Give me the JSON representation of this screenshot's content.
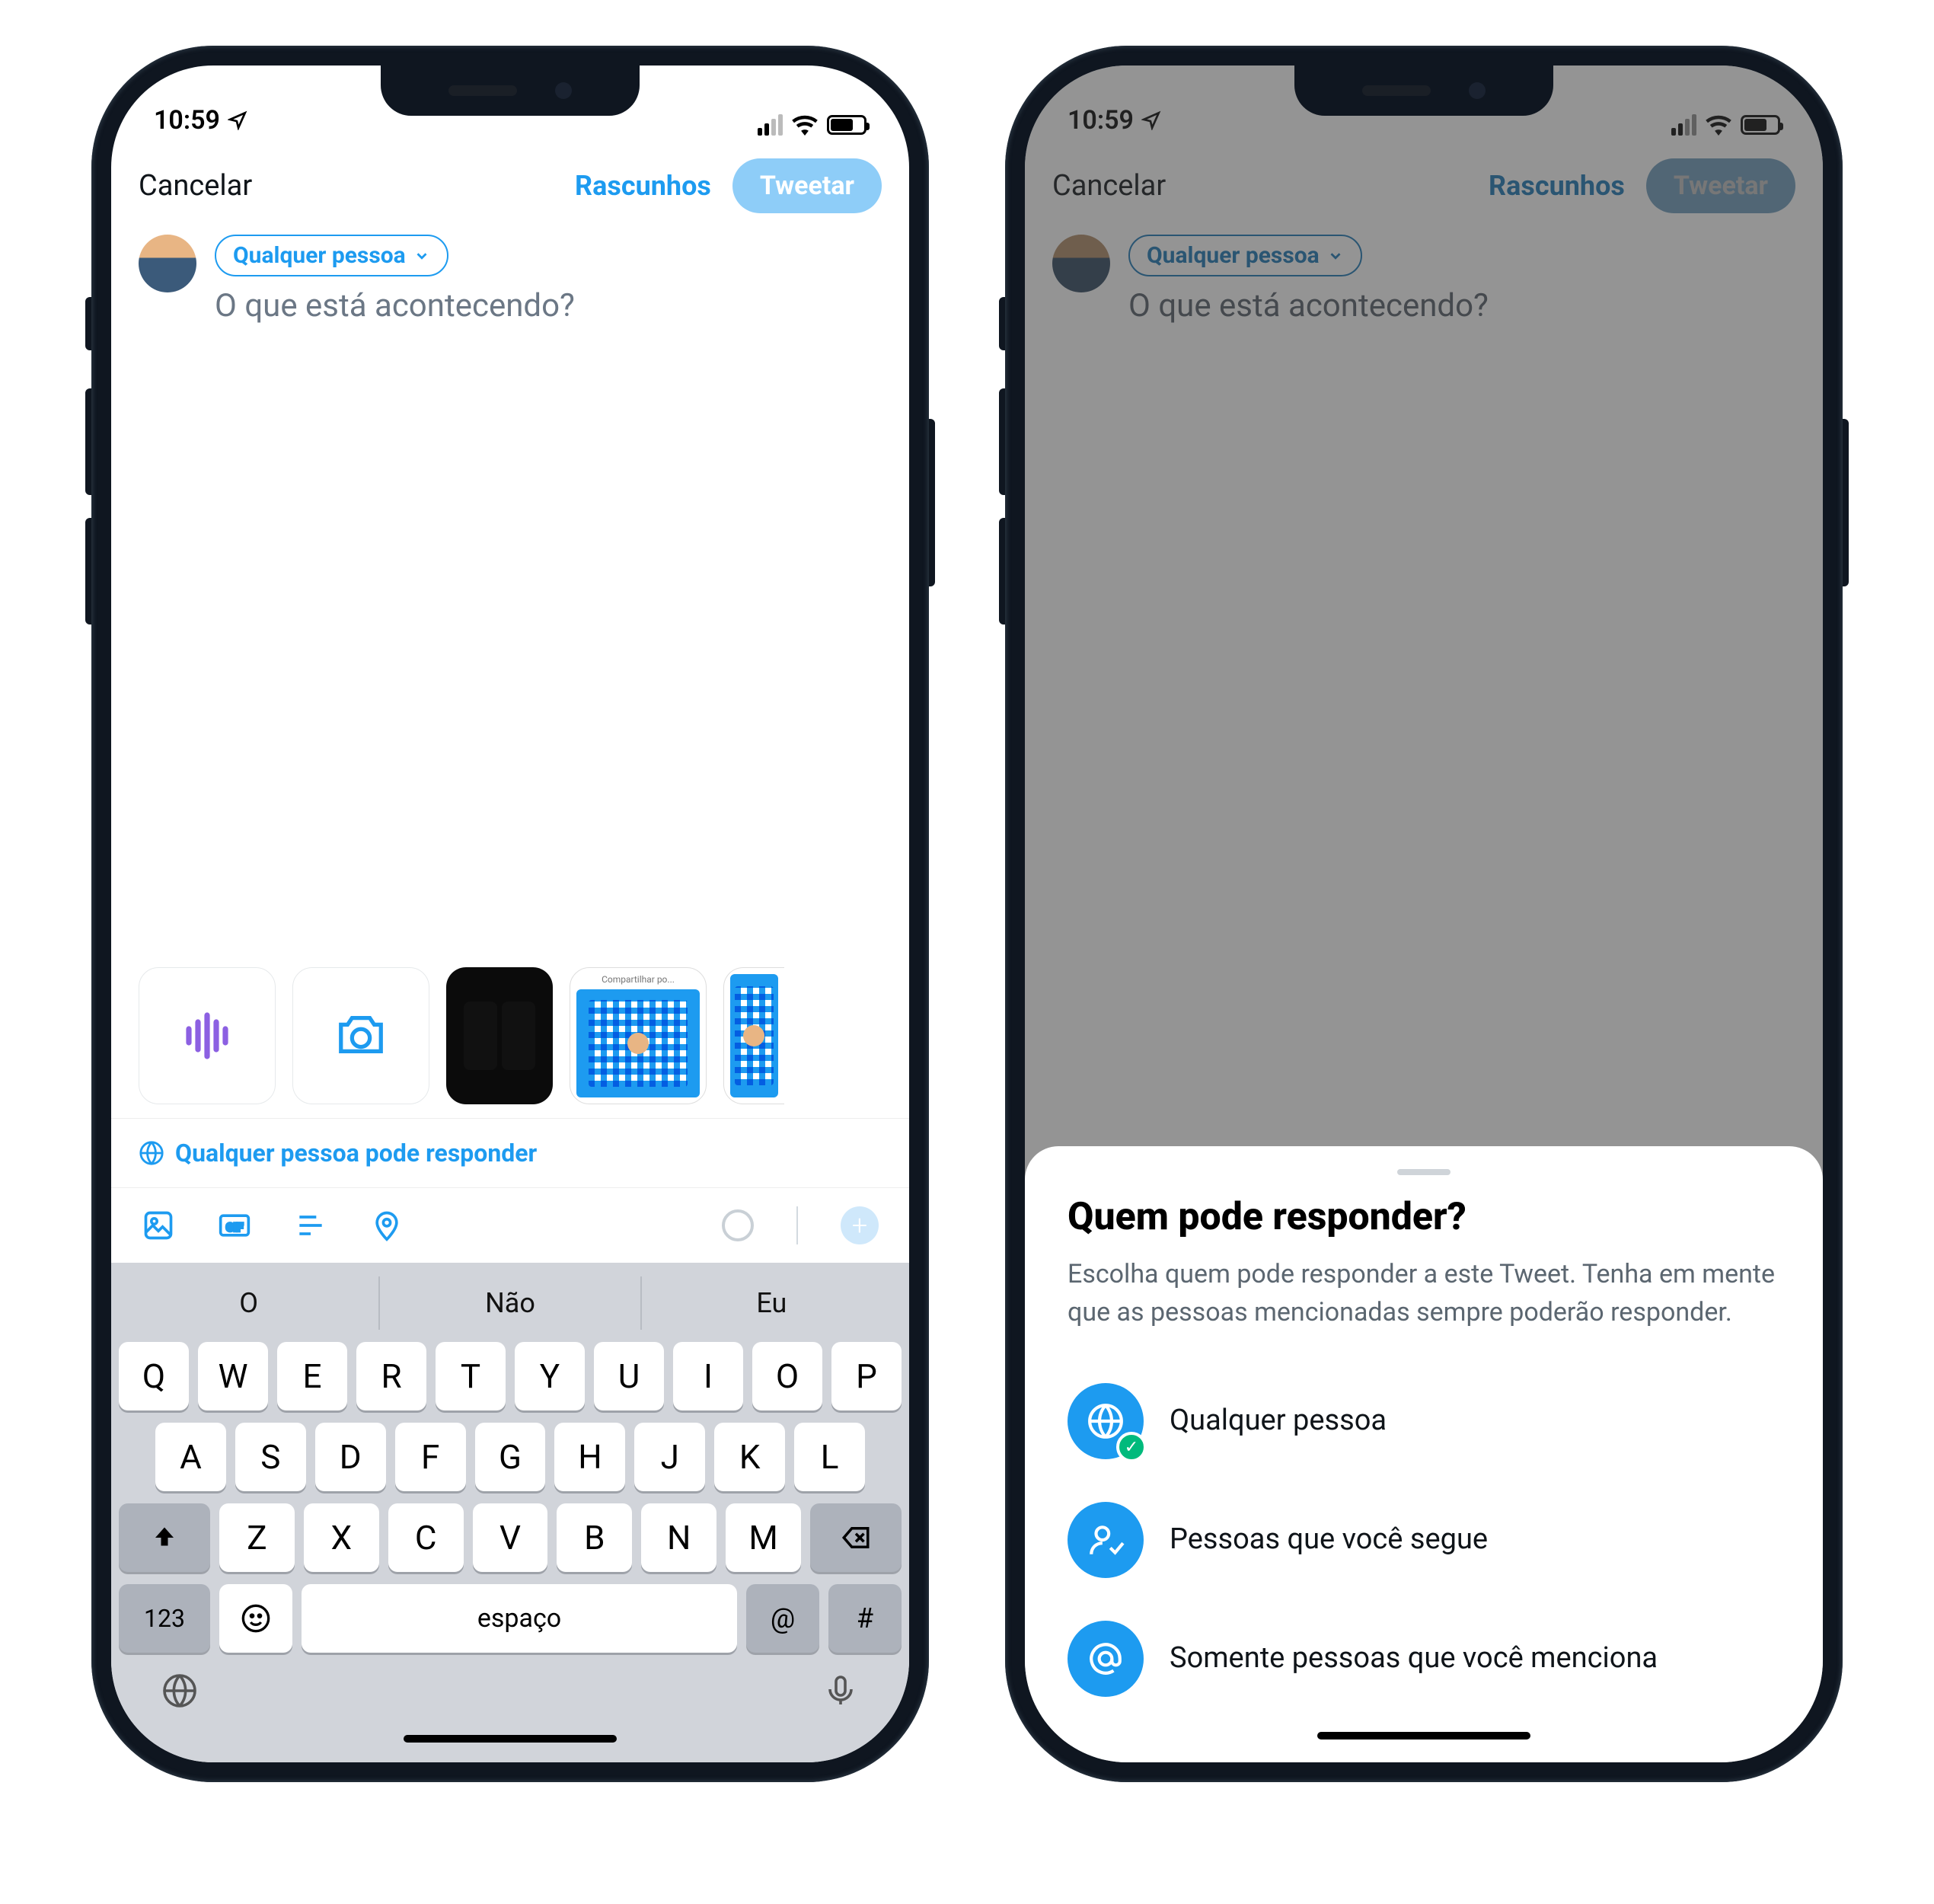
{
  "status": {
    "time": "10:59"
  },
  "nav": {
    "cancel": "Cancelar",
    "drafts": "Rascunhos",
    "tweet": "Tweetar"
  },
  "compose": {
    "audience": "Qualquer pessoa",
    "placeholder": "O que está acontecendo?",
    "reply_hint": "Qualquer pessoa pode responder"
  },
  "keyboard": {
    "suggestions": [
      "O",
      "Não",
      "Eu"
    ],
    "row1": [
      "Q",
      "W",
      "E",
      "R",
      "T",
      "Y",
      "U",
      "I",
      "O",
      "P"
    ],
    "row2": [
      "A",
      "S",
      "D",
      "F",
      "G",
      "H",
      "J",
      "K",
      "L"
    ],
    "row3": [
      "Z",
      "X",
      "C",
      "V",
      "B",
      "N",
      "M"
    ],
    "numkey": "123",
    "space": "espaço",
    "at": "@",
    "hash": "#"
  },
  "sheet": {
    "title": "Quem pode responder?",
    "desc": "Escolha quem pode responder a este Tweet. Tenha em mente que as pessoas mencionadas sempre poderão responder.",
    "opt1": "Qualquer pessoa",
    "opt2": "Pessoas que você segue",
    "opt3": "Somente pessoas que você menciona"
  }
}
